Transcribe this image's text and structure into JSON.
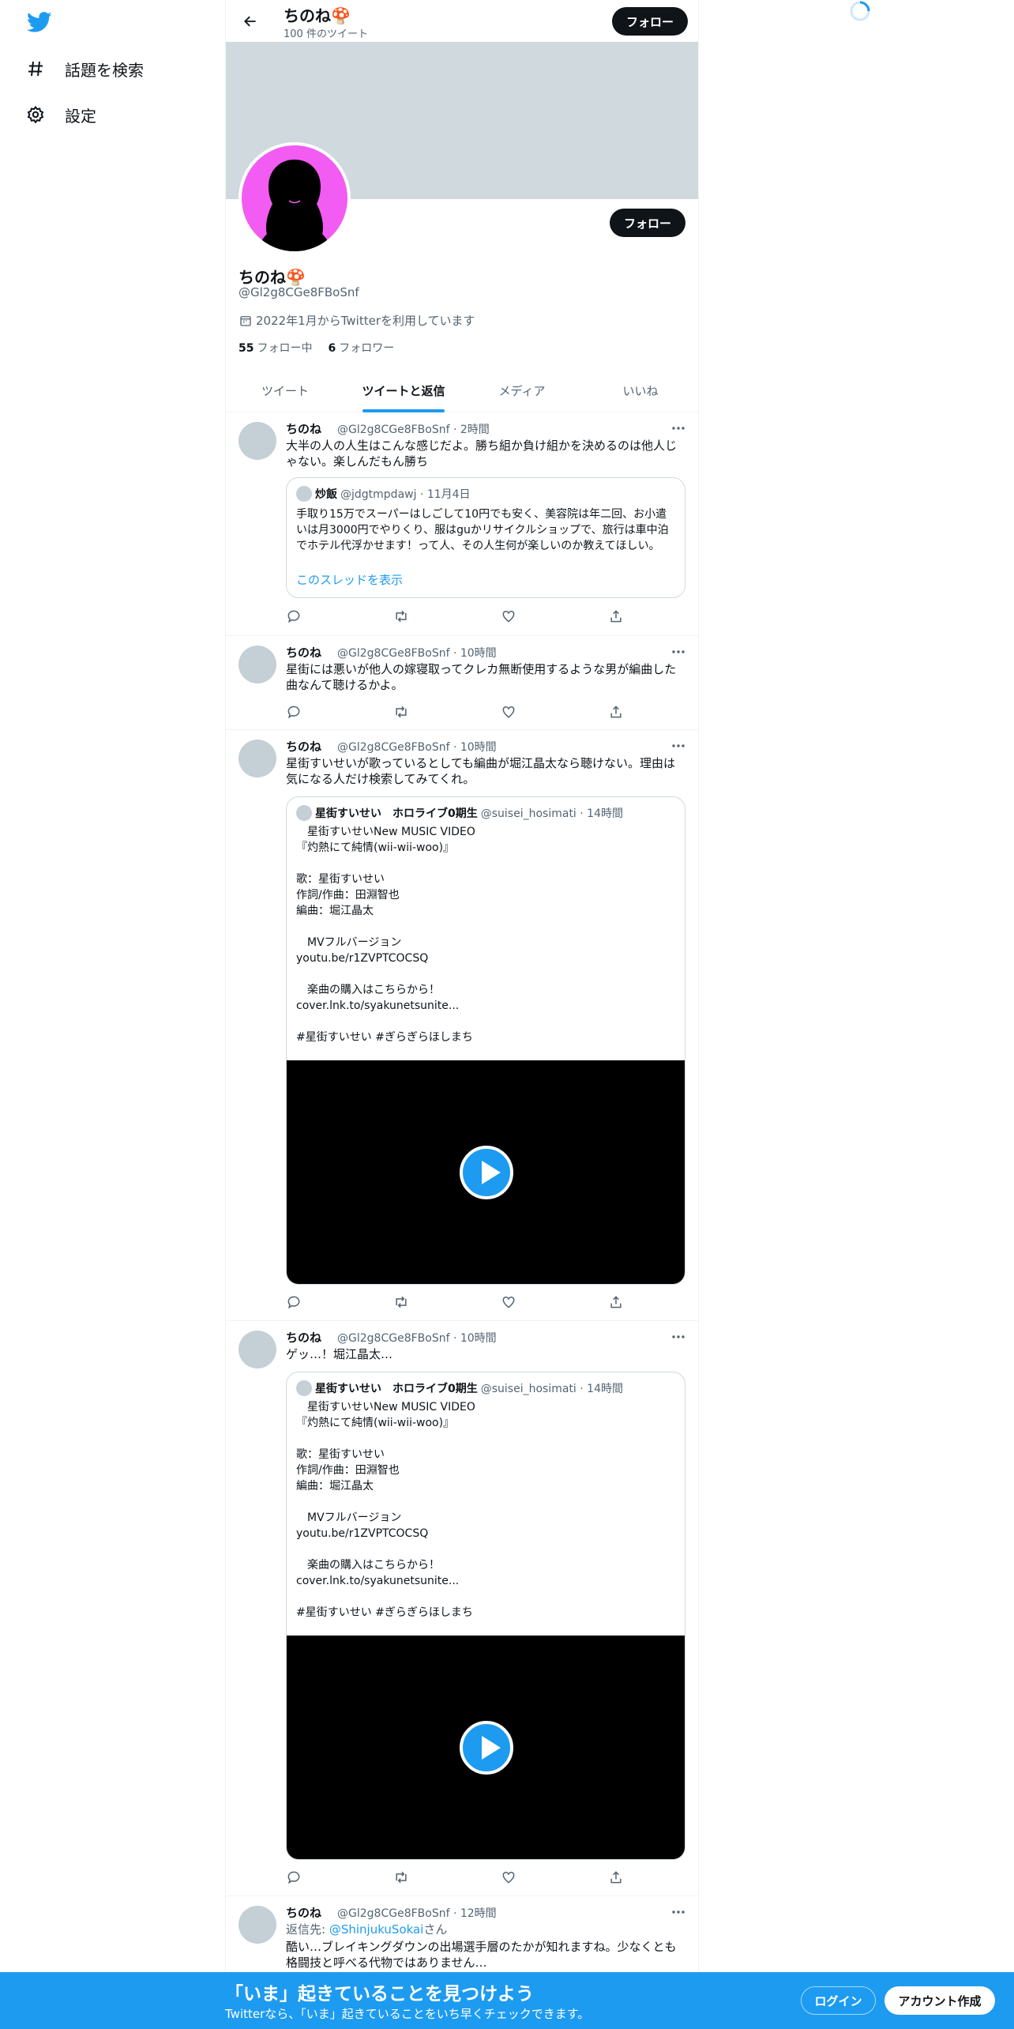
{
  "nav": {
    "logo": "twitter-bird-icon",
    "items": [
      {
        "label": "話題を検索",
        "icon": "hashtag-icon"
      },
      {
        "label": "設定",
        "icon": "gear-icon"
      }
    ]
  },
  "header": {
    "name": "ちのね🍄",
    "tweet_count": "100 件のツイート",
    "follow_label": "フォロー"
  },
  "profile": {
    "name": "ちのね🍄",
    "handle": "@Gl2g8CGe8FBoSnf",
    "joined": "2022年1月からTwitterを利用しています",
    "following_count": "55",
    "following_label": "フォロー中",
    "followers_count": "6",
    "followers_label": "フォロワー",
    "follow_label": "フォロー"
  },
  "tabs": [
    {
      "label": "ツイート",
      "active": false
    },
    {
      "label": "ツイートと返信",
      "active": true
    },
    {
      "label": "メディア",
      "active": false
    },
    {
      "label": "いいね",
      "active": false
    }
  ],
  "tweets": [
    {
      "name": "ちのね",
      "meta": "@Gl2g8CGe8FBoSnf · 2時間",
      "text": "大半の人の人生はこんな感じだよ。勝ち組か負け組かを決めるのは他人じゃない。楽しんだもん勝ち",
      "quote": {
        "name": "炒飯",
        "meta": "@jdgtmpdawj · 11月4日",
        "text": "手取り15万でスーパーはしごして10円でも安く、美容院は年二回、お小遣いは月3000円でやりくり、服はguかリサイクルショップで、旅行は車中泊でホテル代浮かせます！って人、その人生何が楽しいのか教えてほしい。",
        "more": "このスレッドを表示"
      }
    },
    {
      "name": "ちのね",
      "meta": "@Gl2g8CGe8FBoSnf · 10時間",
      "text": "星街には悪いが他人の嫁寝取ってクレカ無断使用するような男が編曲した曲なんて聴けるかよ。"
    },
    {
      "name": "ちのね",
      "meta": "@Gl2g8CGe8FBoSnf · 10時間",
      "text": "星街すいせいが歌っているとしても編曲が堀江晶太なら聴けない。理由は気になる人だけ検索してみてくれ。",
      "quote": {
        "name": "星街すいせい　ホロライブ0期生",
        "meta": "@suisei_hosimati · 14時間",
        "text": "　星街すいせいNew MUSIC VIDEO\n『灼熱にて純情(wii-wii-woo)』\n\n歌：星街すいせい\n作詞/作曲：田淵智也\n編曲：堀江晶太\n\n　MVフルバージョン\nyoutu.be/r1ZVPTCOCSQ\n\n　楽曲の購入はこちらから！\ncover.lnk.to/syakunetsunite...\n\n#星街すいせい #ぎらぎらほしまち"
      }
    },
    {
      "name": "ちのね",
      "meta": "@Gl2g8CGe8FBoSnf · 10時間",
      "text": "ゲッ…！堀江晶太…",
      "quote": {
        "name": "星街すいせい　ホロライブ0期生",
        "meta": "@suisei_hosimati · 14時間",
        "text": "　星街すいせいNew MUSIC VIDEO\n『灼熱にて純情(wii-wii-woo)』\n\n歌：星街すいせい\n作詞/作曲：田淵智也\n編曲：堀江晶太\n\n　MVフルバージョン\nyoutu.be/r1ZVPTCOCSQ\n\n　楽曲の購入はこちらから！\ncover.lnk.to/syakunetsunite...\n\n#星街すいせい #ぎらぎらほしまち"
      }
    },
    {
      "name": "ちのね",
      "meta": "@Gl2g8CGe8FBoSnf · 12時間",
      "reply_prefix": "返信先: ",
      "reply_to": "@ShinjukuSokai",
      "reply_suffix": "さん",
      "text": "酷い…ブレイキングダウンの出場選手層のたかが知れますね。少なくとも格闘技と呼べる代物ではありません…"
    }
  ],
  "bottom_bar": {
    "title": "「いま」起きていることを見つけよう",
    "subtitle": "Twitterなら、「いま」起きていることをいち早くチェックできます。",
    "login": "ログイン",
    "signup": "アカウント作成"
  },
  "colors": {
    "accent": "#1d9bf0",
    "banner": "#cfd9de",
    "avatar_bg": "#f25cf2"
  }
}
